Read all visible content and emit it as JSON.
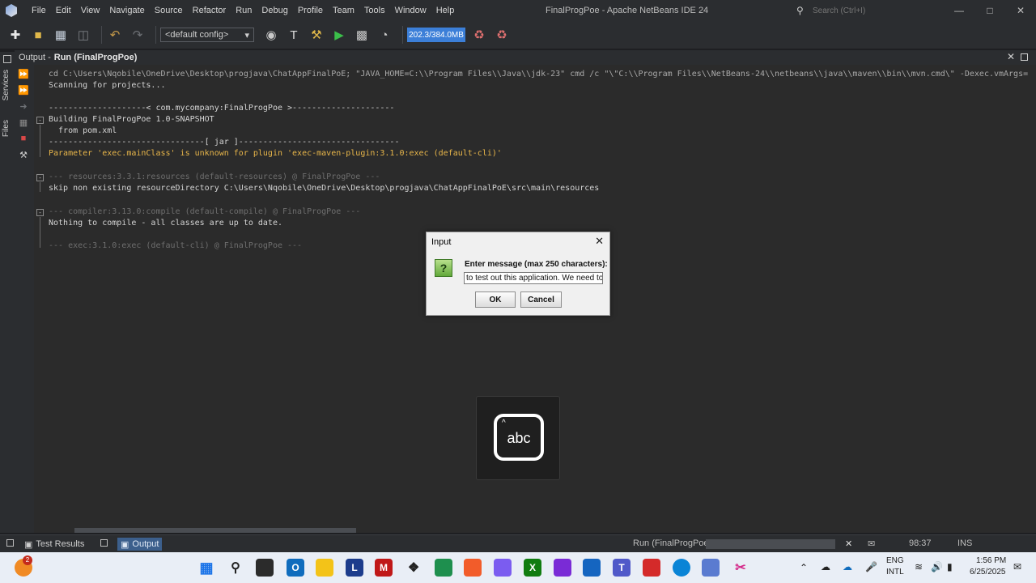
{
  "menu": [
    "File",
    "Edit",
    "View",
    "Navigate",
    "Source",
    "Refactor",
    "Run",
    "Debug",
    "Profile",
    "Team",
    "Tools",
    "Window",
    "Help"
  ],
  "window_title": "FinalProgPoe - Apache NetBeans IDE 24",
  "search": {
    "placeholder": "Search (Ctrl+I)"
  },
  "toolbar": {
    "config": "<default config>",
    "memory": "202.3/384.0MB"
  },
  "sidebar": {
    "services": "Services",
    "files": "Files"
  },
  "output": {
    "label": "Output -",
    "title": "Run (FinalProgPoe)",
    "lines": [
      "cd C:\\Users\\Nqobile\\OneDrive\\Desktop\\progjava\\ChatAppFinalPoE; \"JAVA_HOME=C:\\\\Program Files\\\\Java\\\\jdk-23\" cmd /c \"\\\"C:\\\\Program Files\\\\NetBeans-24\\\\netbeans\\\\java\\\\maven\\\\bin\\\\mvn.cmd\\\" -Dexec.vmArgs=",
      "Scanning for projects...",
      "",
      "--------------------< com.mycompany:FinalProgPoe >---------------------",
      "Building FinalProgPoe 1.0-SNAPSHOT",
      "  from pom.xml",
      "--------------------------------[ jar ]---------------------------------",
      "Parameter 'exec.mainClass' is unknown for plugin 'exec-maven-plugin:3.1.0:exec (default-cli)'",
      "",
      "--- resources:3.3.1:resources (default-resources) @ FinalProgPoe ---",
      "skip non existing resourceDirectory C:\\Users\\Nqobile\\OneDrive\\Desktop\\progjava\\ChatAppFinalPoE\\src\\main\\resources",
      "",
      "--- compiler:3.13.0:compile (default-compile) @ FinalProgPoe ---",
      "Nothing to compile - all classes are up to date.",
      "",
      "--- exec:3.1.0:exec (default-cli) @ FinalProgPoe ---"
    ]
  },
  "dialog": {
    "title": "Input",
    "icon": "?",
    "label": "Enter message (max 250 characters):",
    "value": "to test out this application. We need to",
    "ok": "OK",
    "cancel": "Cancel"
  },
  "abc_badge": "abc",
  "status": {
    "tab1": "Test Results",
    "tab2": "Output",
    "task": "Run (FinalProgPoe)",
    "position": "98:37",
    "mode": "INS"
  },
  "taskbar": {
    "notification_count": "2",
    "lang1": "ENG",
    "lang2": "INTL",
    "time": "1:56 PM",
    "date": "6/25/2025",
    "colors": {
      "accent": "#3c7fd8",
      "console_bg": "#2b2b2b",
      "warning": "#e8b64a"
    }
  }
}
